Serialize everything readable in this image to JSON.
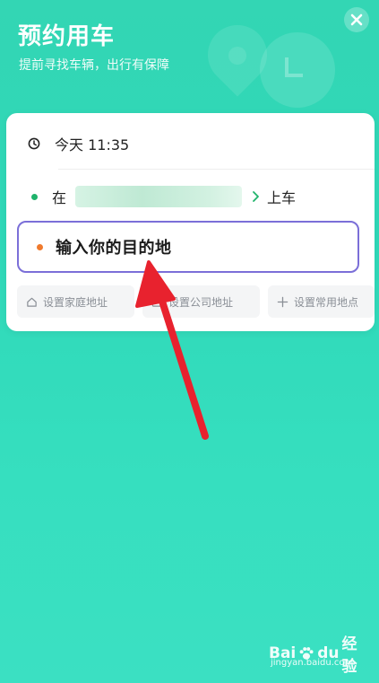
{
  "header": {
    "title": "预约用车",
    "subtitle": "提前寻找车辆，出行有保障",
    "close_icon": "close-icon"
  },
  "trip": {
    "time_label": "今天 11:35",
    "pickup_prefix": "在",
    "pickup_suffix": "上车",
    "destination_placeholder": "输入你的目的地"
  },
  "shortcuts": [
    {
      "label": "设置家庭地址",
      "icon": "home-icon"
    },
    {
      "label": "设置公司地址",
      "icon": "briefcase-icon"
    },
    {
      "label": "设置常用地点",
      "icon": "plus-icon"
    }
  ],
  "watermark": {
    "brand_bai": "Bai",
    "brand_du": "du",
    "brand_jingyan": "经验",
    "url": "jingyan.baidu.com"
  },
  "colors": {
    "background": "#33d6b4",
    "pickup_dot": "#1fb36b",
    "destination_dot": "#f07a2d",
    "destination_border": "#7b6fd8",
    "annotation_arrow": "#e8222e"
  }
}
